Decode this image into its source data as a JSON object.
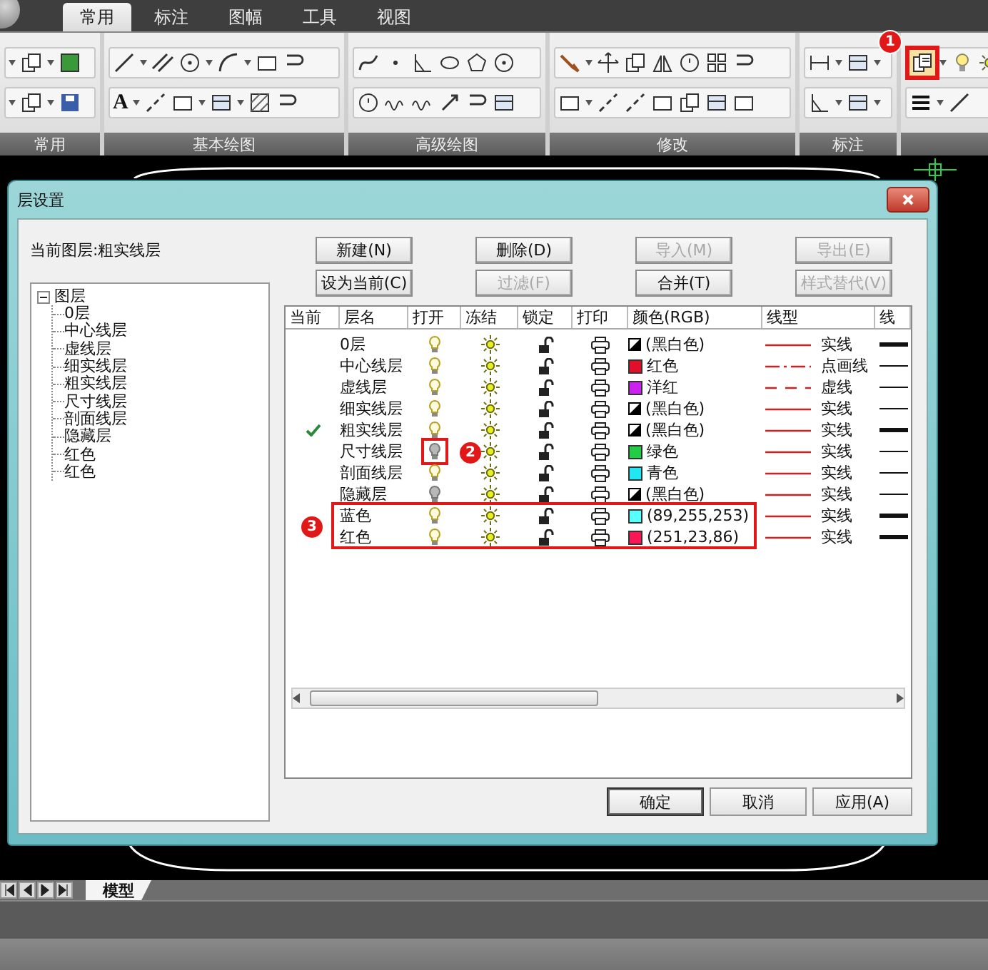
{
  "menu_tabs": [
    {
      "label": "常用",
      "selected": true
    },
    {
      "label": "标注",
      "selected": false
    },
    {
      "label": "图幅",
      "selected": false
    },
    {
      "label": "工具",
      "selected": false
    },
    {
      "label": "视图",
      "selected": false
    }
  ],
  "ribbon": {
    "panels": [
      {
        "label": "常用"
      },
      {
        "label": "基本绘图"
      },
      {
        "label": "高级绘图"
      },
      {
        "label": "修改"
      },
      {
        "label": "标注"
      }
    ],
    "text_tool": "A",
    "layer_button_callout": "1"
  },
  "dialog": {
    "title": "层设置",
    "current_layer": "当前图层:粗实线层",
    "tree": {
      "label": "图层",
      "expanded": true,
      "children": [
        {
          "label": "0层"
        },
        {
          "label": "中心线层"
        },
        {
          "label": "虚线层"
        },
        {
          "label": "细实线层"
        },
        {
          "label": "粗实线层"
        },
        {
          "label": "尺寸线层"
        },
        {
          "label": "剖面线层"
        },
        {
          "label": "隐藏层"
        },
        {
          "label": "红色"
        },
        {
          "label": "红色"
        }
      ]
    },
    "buttons": [
      {
        "label": "新建(N)",
        "disabled": false
      },
      {
        "label": "删除(D)",
        "disabled": false
      },
      {
        "label": "导入(M)",
        "disabled": true
      },
      {
        "label": "导出(E)",
        "disabled": true
      },
      {
        "label": "设为当前(C)",
        "disabled": false
      },
      {
        "label": "过滤(F)",
        "disabled": true
      },
      {
        "label": "合并(T)",
        "disabled": false
      },
      {
        "label": "样式替代(V)",
        "disabled": true
      }
    ],
    "table": {
      "columns": [
        "当前",
        "层名",
        "打开",
        "冻结",
        "锁定",
        "打印",
        "颜色(RGB)",
        "线型",
        "线"
      ],
      "rows": [
        {
          "current": false,
          "name": "0层",
          "on": true,
          "frozen": false,
          "locked": false,
          "plot": true,
          "swatch": {
            "kind": "bw",
            "color": "#000000"
          },
          "color_name": "(黑白色)",
          "linetype": {
            "kind": "solid",
            "label": "实线"
          },
          "lineweight": {
            "kind": "thick"
          }
        },
        {
          "current": false,
          "name": "中心线层",
          "on": true,
          "frozen": false,
          "locked": false,
          "plot": true,
          "swatch": {
            "kind": "solid",
            "color": "#e0102a"
          },
          "color_name": "红色",
          "linetype": {
            "kind": "dashdot",
            "label": "点画线"
          },
          "lineweight": {
            "kind": "thin"
          }
        },
        {
          "current": false,
          "name": "虚线层",
          "on": true,
          "frozen": false,
          "locked": false,
          "plot": true,
          "swatch": {
            "kind": "solid",
            "color": "#cc22ee"
          },
          "color_name": "洋红",
          "linetype": {
            "kind": "dashed",
            "label": "虚线"
          },
          "lineweight": {
            "kind": "thin"
          }
        },
        {
          "current": false,
          "name": "细实线层",
          "on": true,
          "frozen": false,
          "locked": false,
          "plot": true,
          "swatch": {
            "kind": "bw",
            "color": "#000000"
          },
          "color_name": "(黑白色)",
          "linetype": {
            "kind": "solid",
            "label": "实线"
          },
          "lineweight": {
            "kind": "thin"
          }
        },
        {
          "current": true,
          "name": "粗实线层",
          "on": true,
          "frozen": false,
          "locked": false,
          "plot": true,
          "swatch": {
            "kind": "bw",
            "color": "#000000"
          },
          "color_name": "(黑白色)",
          "linetype": {
            "kind": "solid",
            "label": "实线"
          },
          "lineweight": {
            "kind": "thick"
          }
        },
        {
          "current": false,
          "name": "尺寸线层",
          "on": false,
          "callout": "2",
          "frozen": false,
          "locked": false,
          "plot": true,
          "swatch": {
            "kind": "solid",
            "color": "#22cc44"
          },
          "color_name": "绿色",
          "linetype": {
            "kind": "solid",
            "label": "实线"
          },
          "lineweight": {
            "kind": "thin"
          }
        },
        {
          "current": false,
          "name": "剖面线层",
          "on": true,
          "frozen": false,
          "locked": false,
          "plot": true,
          "swatch": {
            "kind": "solid",
            "color": "#22e6f2"
          },
          "color_name": "青色",
          "linetype": {
            "kind": "solid",
            "label": "实线"
          },
          "lineweight": {
            "kind": "thin"
          }
        },
        {
          "current": false,
          "name": "隐藏层",
          "on": false,
          "frozen": false,
          "locked": false,
          "plot": true,
          "swatch": {
            "kind": "bw",
            "color": "#000000"
          },
          "color_name": "(黑白色)",
          "linetype": {
            "kind": "solid",
            "label": "实线"
          },
          "lineweight": {
            "kind": "thin"
          }
        }
      ],
      "highlight": {
        "callout": "3",
        "rows": [
          {
            "current": false,
            "name": "蓝色",
            "on": true,
            "frozen": false,
            "locked": false,
            "plot": true,
            "swatch": {
              "kind": "solid",
              "color": "#59fffd"
            },
            "color_name": "(89,255,253)",
            "linetype": {
              "kind": "solid",
              "label": "实线"
            },
            "lineweight": {
              "kind": "thick"
            }
          },
          {
            "current": false,
            "name": "红色",
            "on": true,
            "frozen": false,
            "locked": false,
            "plot": true,
            "swatch": {
              "kind": "solid",
              "color": "#fb1756"
            },
            "color_name": "(251,23,86)",
            "linetype": {
              "kind": "solid",
              "label": "实线"
            },
            "lineweight": {
              "kind": "thick"
            }
          }
        ]
      }
    },
    "footer_buttons": [
      {
        "label": "确定",
        "default": true
      },
      {
        "label": "取消",
        "default": false
      },
      {
        "label": "应用(A)",
        "default": false
      }
    ]
  },
  "layout_tabs": [
    {
      "label": "模型",
      "selected": true
    }
  ]
}
